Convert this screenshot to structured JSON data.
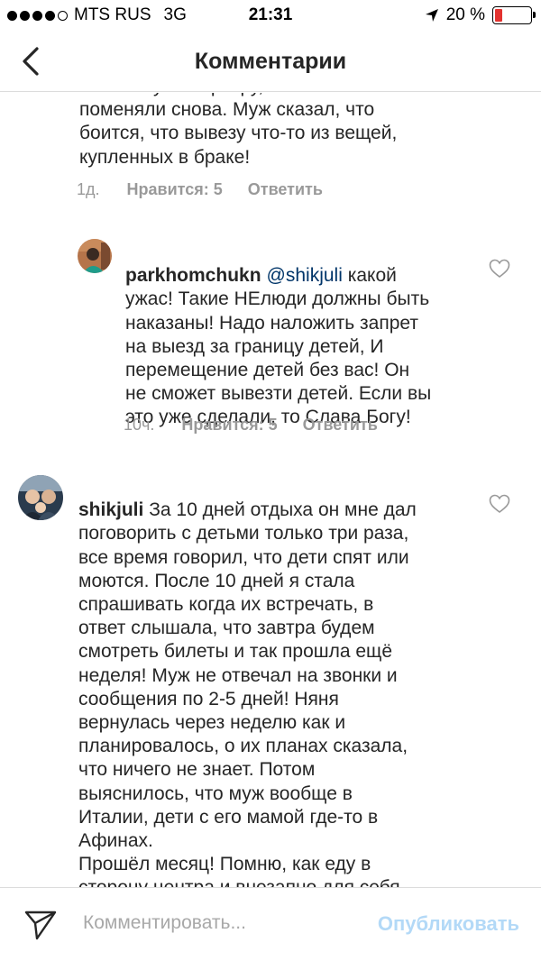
{
  "status_bar": {
    "carrier": "MTS RUS",
    "network": "3G",
    "time": "21:31",
    "battery_percent": "20 %",
    "battery_level": 0.2,
    "signal_bars_filled": 4,
    "location_icon": "location-arrow-icon"
  },
  "nav": {
    "title": "Комментарии",
    "back_icon": "chevron-left-icon"
  },
  "comments": [
    {
      "text": "маленькую квартиру, после чего замки\nпоменяли снова. Муж сказал, что\nбоится, что вывезу что-то из вещей,\nкупленных в браке!",
      "time": "1д.",
      "likes": "Нравится: 5",
      "reply": "Ответить"
    },
    {
      "username": "parkhomchukn",
      "mention": "@shikjuli",
      "text_first": " какой",
      "text": "ужас! Такие НЕлюди должны быть\nнаказаны! Надо наложить запрет\nна выезд за границу детей,  И\nперемещение детей без вас! Он\nне сможет вывезти детей. Если вы\nэто уже сделали, то Слава Богу!",
      "time": "10ч.",
      "likes": "Нравится: 5",
      "reply": "Ответить"
    },
    {
      "username": "shikjuli",
      "text_first": " За 10 дней отдыха он мне дал",
      "text": "поговорить с детьми только три раза,\nвсе время говорил, что дети спят или\nмоются. После 10 дней я стала\nспрашивать когда их встречать, в\nответ слышала, что завтра будем\nсмотреть билеты и так прошла ещё\nнеделя! Муж не отвечал на звонки и\nсообщения по 2-5 дней!  Няня\nвернулась через неделю как и\nпланировалось, о их планах сказала,\nчто ничего не знает. Потом\nвыяснилось, что муж вообще в\nИталии, дети с его мамой где-то в\nАфинах.\nПрошёл месяц! Помню, как еду в\nсторону центра и внезапно для себя\nрешаю, что нужно ехать на работу к"
    }
  ],
  "footer": {
    "placeholder": "Комментировать...",
    "publish": "Опубликовать"
  },
  "colors": {
    "text": "#262626",
    "meta": "#999999",
    "mention": "#003569",
    "publish_disabled": "#b3d9f7",
    "battery_low": "#e3322f"
  }
}
